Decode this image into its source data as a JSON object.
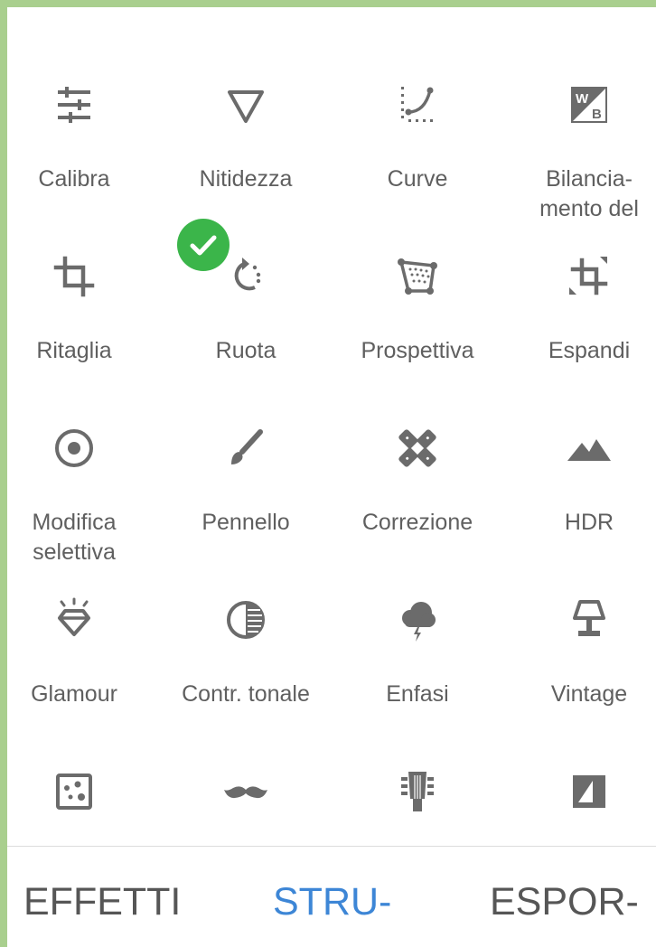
{
  "tools_row1": [
    {
      "label": "Calibra",
      "icon": "tune-sliders-icon"
    },
    {
      "label": "Nitidezza",
      "icon": "triangle-down-icon"
    },
    {
      "label": "Curve",
      "icon": "curve-icon"
    },
    {
      "label": "Bilancia-\nmento del",
      "icon": "white-balance-icon"
    }
  ],
  "tools_row2": [
    {
      "label": "Ritaglia",
      "icon": "crop-icon"
    },
    {
      "label": "Ruota",
      "icon": "rotate-icon"
    },
    {
      "label": "Prospettiva",
      "icon": "perspective-icon"
    },
    {
      "label": "Espandi",
      "icon": "expand-icon"
    }
  ],
  "tools_row3": [
    {
      "label": "Modifica\nselettiva",
      "icon": "selective-target-icon"
    },
    {
      "label": "Pennello",
      "icon": "brush-icon"
    },
    {
      "label": "Correzione",
      "icon": "healing-bandage-icon"
    },
    {
      "label": "HDR",
      "icon": "mountains-icon"
    }
  ],
  "tools_row4": [
    {
      "label": "Glamour",
      "icon": "diamond-glow-icon"
    },
    {
      "label": "Contr. tonale",
      "icon": "tonal-contrast-icon"
    },
    {
      "label": "Enfasi",
      "icon": "storm-cloud-icon"
    },
    {
      "label": "Vintage",
      "icon": "lamp-icon"
    }
  ],
  "tools_row5": [
    {
      "icon": "grain-dice-icon"
    },
    {
      "icon": "mustache-icon"
    },
    {
      "icon": "guitar-head-icon"
    },
    {
      "icon": "frame-icon"
    }
  ],
  "selected_tool_badge": "check-icon",
  "tabs": {
    "effects": "EFFETTI",
    "tools": "STRU-",
    "export": "ESPOR-"
  },
  "colors": {
    "icon": "#6b6b6b",
    "label": "#5f5f5f",
    "active_tab": "#3d86d6",
    "check_badge": "#3bb54a",
    "frame_border": "#a9cf8e"
  }
}
